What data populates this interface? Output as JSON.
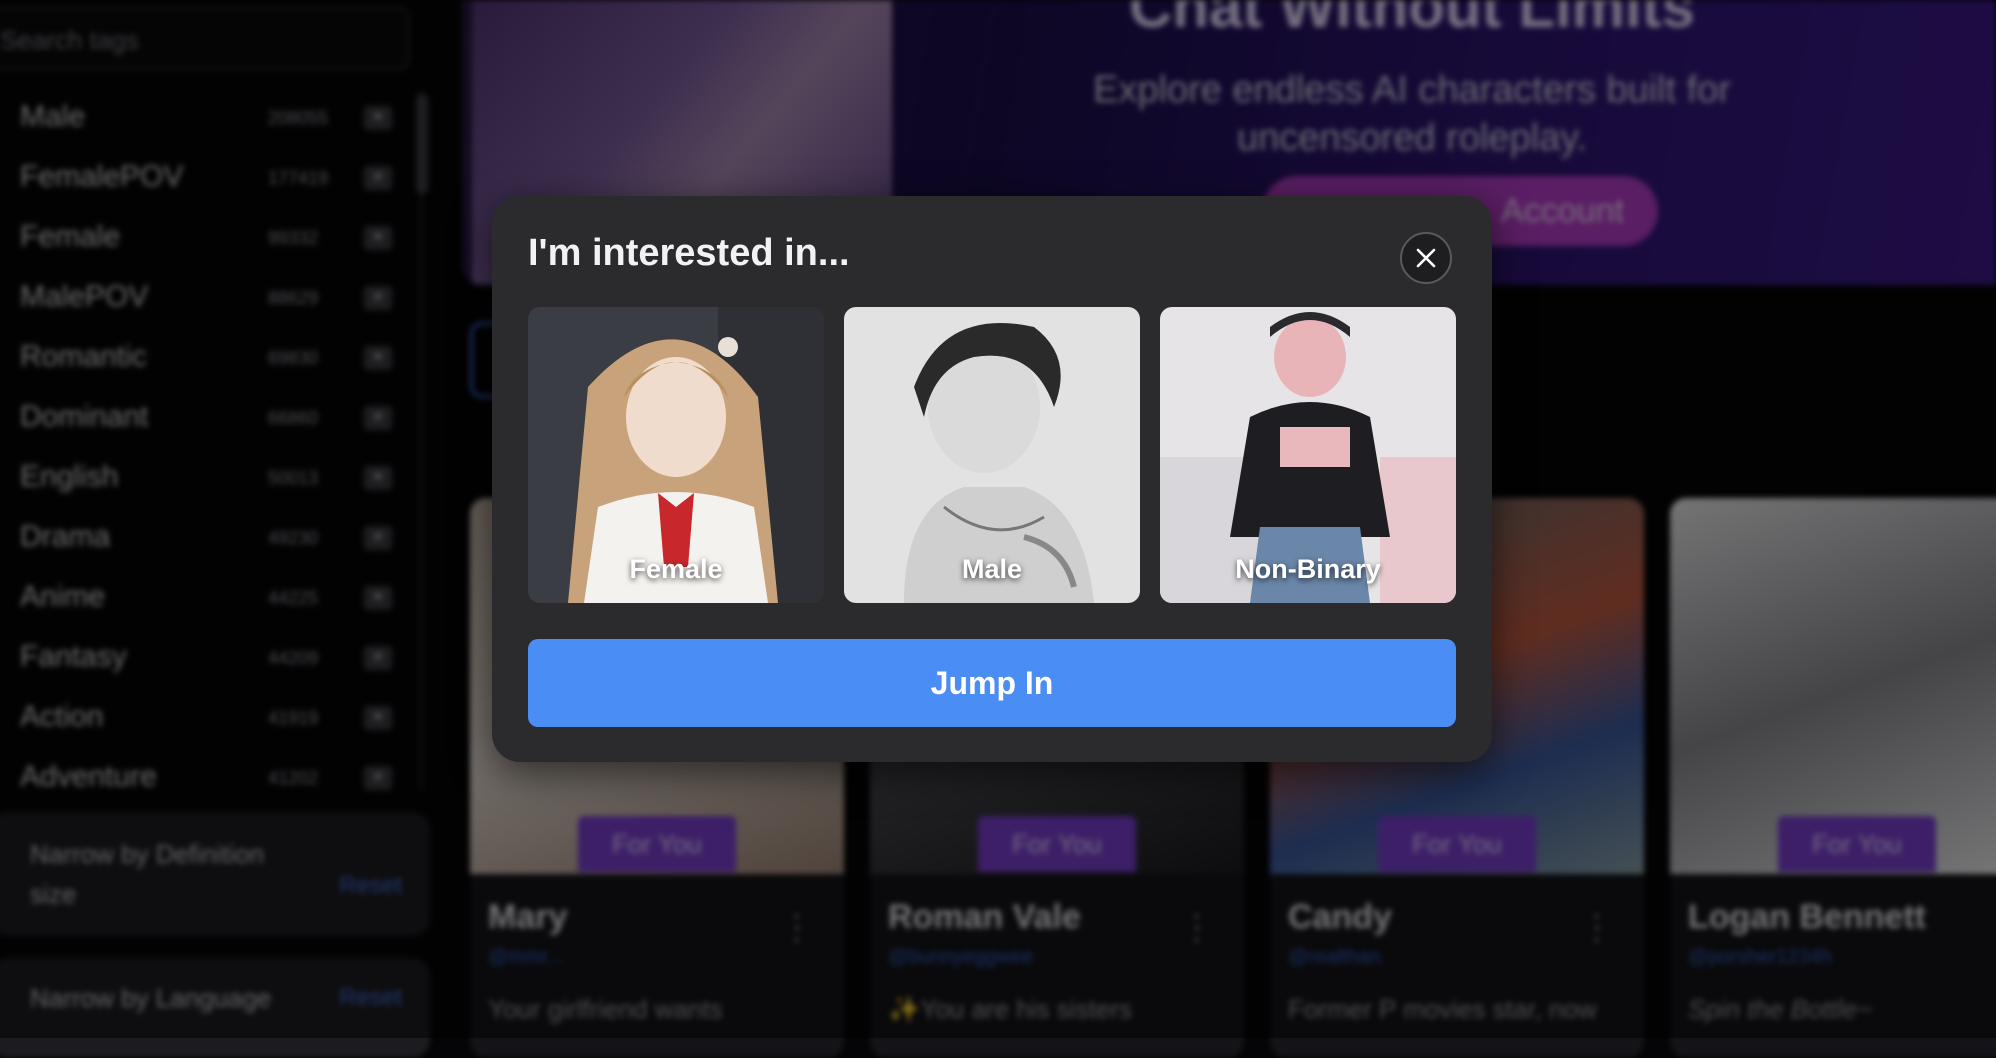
{
  "sidebar": {
    "search_placeholder": "Search tags",
    "tags": [
      {
        "name": "Male",
        "count": "208055"
      },
      {
        "name": "FemalePOV",
        "count": "177419"
      },
      {
        "name": "Female",
        "count": "99332"
      },
      {
        "name": "MalePOV",
        "count": "88629"
      },
      {
        "name": "Romantic",
        "count": "69830"
      },
      {
        "name": "Dominant",
        "count": "66860"
      },
      {
        "name": "English",
        "count": "50013"
      },
      {
        "name": "Drama",
        "count": "49230"
      },
      {
        "name": "Anime",
        "count": "44225"
      },
      {
        "name": "Fantasy",
        "count": "44209"
      },
      {
        "name": "Action",
        "count": "41919"
      },
      {
        "name": "Adventure",
        "count": "41202"
      }
    ],
    "filters": [
      {
        "label": "Narrow by Definition size",
        "reset": "Reset"
      },
      {
        "label": "Narrow by Language",
        "reset": "Reset"
      }
    ]
  },
  "banner": {
    "title": "Chat Without Limits",
    "subtitle": "Explore endless AI characters built for uncensored roleplay.",
    "cta": "Account"
  },
  "cards": [
    {
      "badge": "For You",
      "name": "Mary",
      "handle": "@mmr...",
      "description": "Your girlfriend wants"
    },
    {
      "badge": "For You",
      "name": "Roman Vale",
      "handle": "@bunnyeggwee",
      "description": "✨You are his sisters"
    },
    {
      "badge": "For You",
      "name": "Candy",
      "handle": "@realthan",
      "description": "Former P movies star, now"
    },
    {
      "badge": "For You",
      "name": "Logan Bennett",
      "handle": "@porsher1234h",
      "description": "Spin the Bottle~"
    }
  ],
  "modal": {
    "title": "I'm interested in...",
    "options": [
      {
        "label": "Female"
      },
      {
        "label": "Male"
      },
      {
        "label": "Non-Binary"
      }
    ],
    "submit_label": "Jump In"
  }
}
